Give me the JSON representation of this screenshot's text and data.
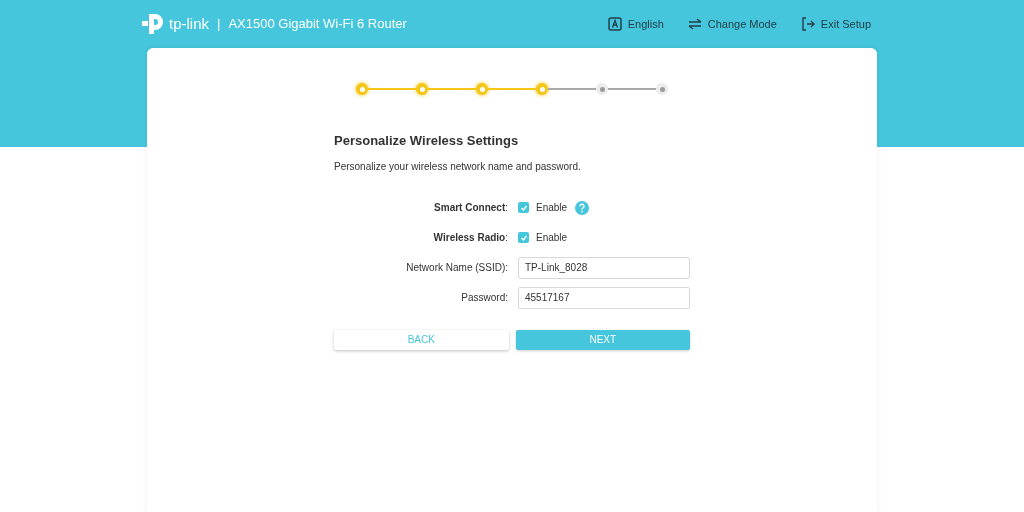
{
  "header": {
    "brand": "tp-link",
    "separator": "|",
    "title": "AX1500 Gigabit Wi-Fi 6 Router",
    "actions": [
      {
        "kind": "language",
        "label": "English"
      },
      {
        "kind": "mode",
        "label": "Change Mode"
      },
      {
        "kind": "exit",
        "label": "Exit Setup"
      }
    ]
  },
  "steps": [
    {
      "completed": true
    },
    {
      "completed": true
    },
    {
      "completed": true
    },
    {
      "completed": true
    },
    {
      "completed": false
    },
    {
      "completed": false
    }
  ],
  "form": {
    "title": "Personalize Wireless Settings",
    "subtitle": "Personalize your wireless network name and password.",
    "rows": [
      {
        "kind": "checkbox",
        "label": "**Smart Connect**:",
        "option": "Enable",
        "checked": true,
        "help": true
      },
      {
        "kind": "checkbox",
        "label": "**Wireless Radio**:",
        "option": "Enable",
        "checked": true,
        "help": false
      },
      {
        "kind": "text",
        "label": "Network Name (SSID):",
        "value": "TP-Link_8028"
      },
      {
        "kind": "text",
        "label": "Password:",
        "value": "45517167"
      }
    ],
    "buttons": [
      {
        "kind": "secondary",
        "label": "BACK"
      },
      {
        "kind": "primary",
        "label": "NEXT"
      }
    ]
  }
}
